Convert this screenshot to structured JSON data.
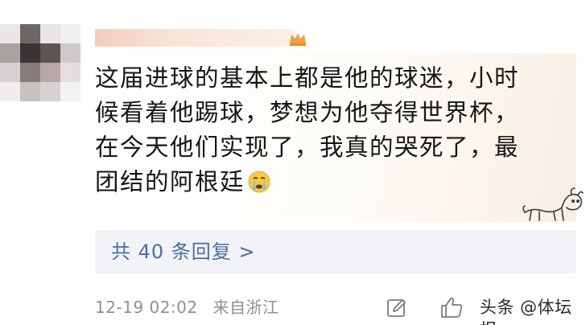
{
  "comment": {
    "text_line_1": "这届进球的基本上都是他的球迷，小时",
    "text_line_2": "候看着他踢球，梦想为他夺得世界杯，",
    "text_line_3": "在今天他们实现了，我真的哭死了，最",
    "text_line_4": "团结的阿根廷",
    "emoji": "crying-face-icon"
  },
  "replies": {
    "link_label": "共 40 条回复 >"
  },
  "meta": {
    "timestamp": "12-19 02:02",
    "location": "来自浙江"
  },
  "actions": {
    "edit_icon": "edit-icon",
    "like_icon": "thumbs-up-icon"
  },
  "watermark": {
    "text": "头条 @体坛报"
  },
  "colors": {
    "link": "#4b6ea6",
    "meta": "#8f8f8f",
    "reply_bg": "#f2f3f7"
  }
}
